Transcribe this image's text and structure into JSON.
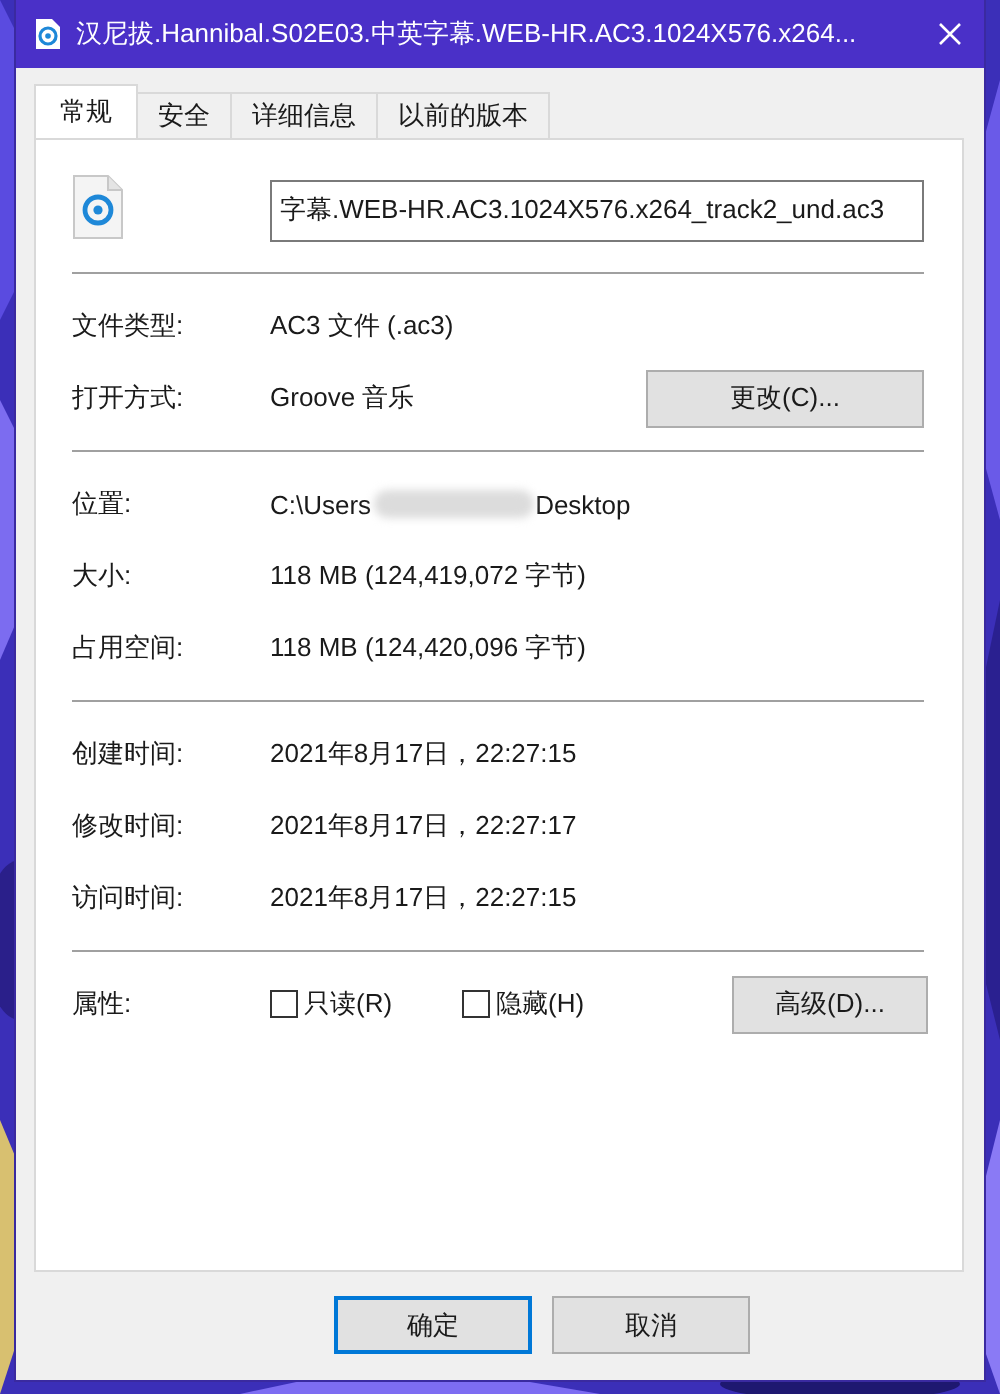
{
  "window": {
    "title": "汉尼拔.Hannibal.S02E03.中英字幕.WEB-HR.AC3.1024X576.x264..."
  },
  "tabs": [
    {
      "label": "常规",
      "selected": true
    },
    {
      "label": "安全",
      "selected": false
    },
    {
      "label": "详细信息",
      "selected": false
    },
    {
      "label": "以前的版本",
      "selected": false
    }
  ],
  "file": {
    "name": "字幕.WEB-HR.AC3.1024X576.x264_track2_und.ac3"
  },
  "sections": [
    [
      {
        "kind": "text",
        "label": "文件类型:",
        "value": "AC3 文件 (.ac3)"
      },
      {
        "kind": "button",
        "label": "打开方式:",
        "value": "Groove 音乐",
        "button": "更改(C)..."
      }
    ],
    [
      {
        "kind": "redacted",
        "label": "位置:",
        "before": "C:\\Users",
        "after": "Desktop"
      },
      {
        "kind": "text",
        "label": "大小:",
        "value": "118 MB (124,419,072 字节)"
      },
      {
        "kind": "text",
        "label": "占用空间:",
        "value": "118 MB (124,420,096 字节)"
      }
    ],
    [
      {
        "kind": "text",
        "label": "创建时间:",
        "value": "2021年8月17日，22:27:15"
      },
      {
        "kind": "text",
        "label": "修改时间:",
        "value": "2021年8月17日，22:27:17"
      },
      {
        "kind": "text",
        "label": "访问时间:",
        "value": "2021年8月17日，22:27:15"
      }
    ],
    [
      {
        "kind": "checkboxes",
        "label": "属性:",
        "options": [
          {
            "label": "只读(R)",
            "checked": false
          },
          {
            "label": "隐藏(H)",
            "checked": false
          }
        ],
        "button": "高级(D)..."
      }
    ]
  ],
  "footer_buttons": [
    {
      "label": "确定",
      "default": true
    },
    {
      "label": "取消",
      "default": false
    }
  ]
}
